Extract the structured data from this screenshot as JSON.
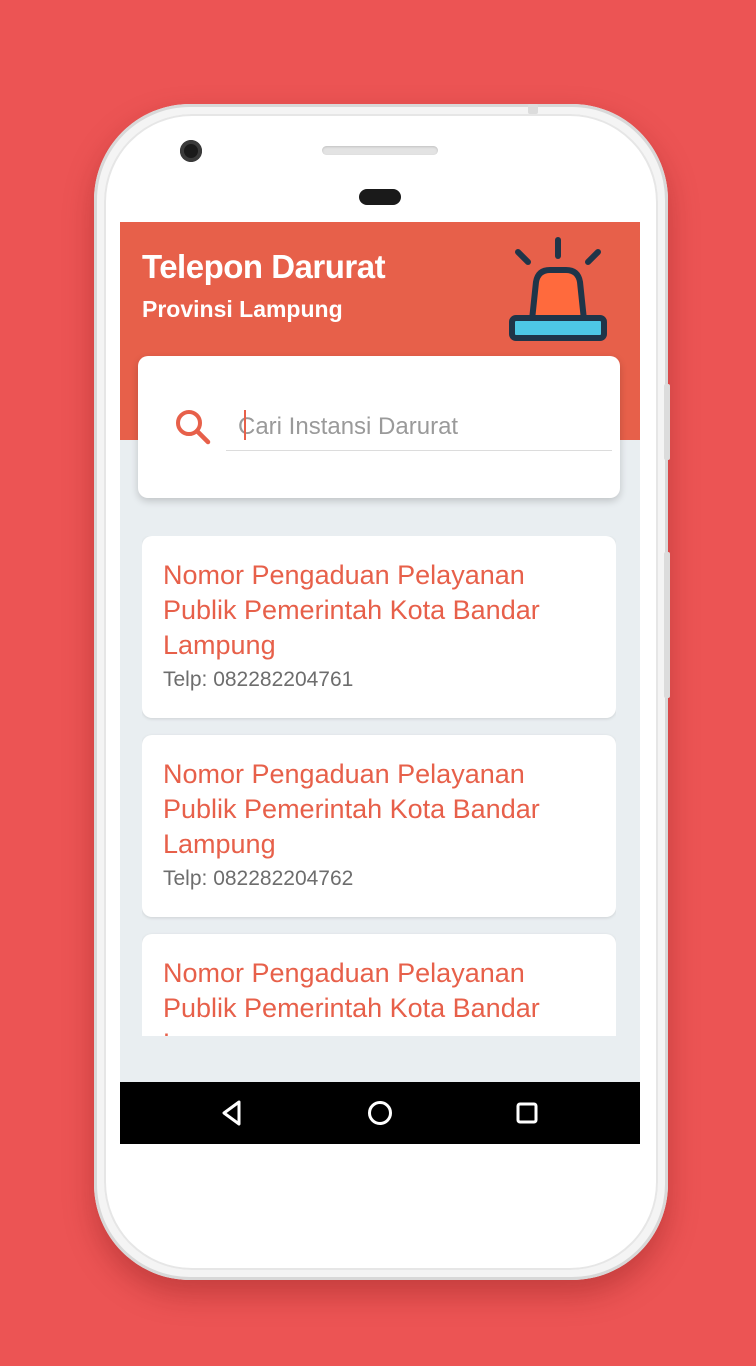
{
  "app": {
    "title": "Telepon Darurat",
    "subtitle": "Provinsi Lampung",
    "header_color": "#e7604a",
    "background_color": "#ec5454"
  },
  "search": {
    "placeholder": "Cari Instansi Darurat",
    "value": ""
  },
  "items": [
    {
      "title": "Nomor Pengaduan Pelayanan Publik Pemerintah Kota Bandar Lampung",
      "phone": "Telp: 082282204761"
    },
    {
      "title": "Nomor Pengaduan Pelayanan Publik Pemerintah Kota Bandar Lampung",
      "phone": "Telp: 082282204762"
    },
    {
      "title": "Nomor Pengaduan Pelayanan Publik Pemerintah Kota Bandar Lampung",
      "phone": ""
    }
  ],
  "icons": {
    "header": "siren-icon",
    "search": "search-icon",
    "nav_back": "back-triangle-icon",
    "nav_home": "home-circle-icon",
    "nav_recents": "recents-square-icon"
  }
}
